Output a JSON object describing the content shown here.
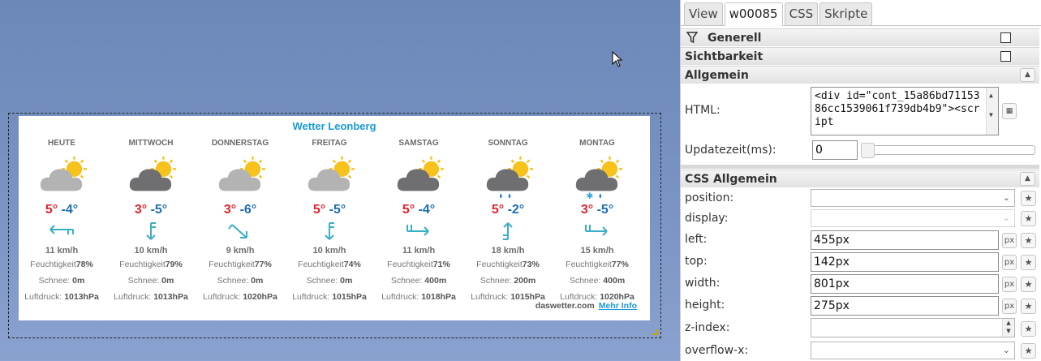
{
  "widget": {
    "title": "Wetter Leonberg",
    "source": "daswetter.com",
    "more_info": "Mehr Info",
    "labels": {
      "humidity": "Feuchtigkeit",
      "snow": "Schnee:",
      "pressure": "Luftdruck:"
    },
    "days": [
      {
        "name": "HEUTE",
        "icon": "partly-cloudy-icon",
        "max": "5°",
        "min": "-4°",
        "wind_icon": "wind-arrow-west-icon",
        "wind": "11 km/h",
        "humidity": "78%",
        "snow": "0m",
        "pressure": "1013hPa"
      },
      {
        "name": "MITTWOCH",
        "icon": "cloudy-sun-icon",
        "max": "3°",
        "min": "-5°",
        "wind_icon": "wind-arrow-south-icon",
        "wind": "10 km/h",
        "humidity": "79%",
        "snow": "0m",
        "pressure": "1013hPa"
      },
      {
        "name": "DONNERSTAG",
        "icon": "partly-cloudy-icon",
        "max": "3°",
        "min": "-6°",
        "wind_icon": "wind-arrow-southeast-icon",
        "wind": "9 km/h",
        "humidity": "77%",
        "snow": "0m",
        "pressure": "1020hPa"
      },
      {
        "name": "FREITAG",
        "icon": "partly-cloudy-icon",
        "max": "5°",
        "min": "-5°",
        "wind_icon": "wind-arrow-south-icon",
        "wind": "10 km/h",
        "humidity": "74%",
        "snow": "0m",
        "pressure": "1015hPa"
      },
      {
        "name": "SAMSTAG",
        "icon": "cloudy-sun-icon",
        "max": "5°",
        "min": "-4°",
        "wind_icon": "wind-arrow-east-icon",
        "wind": "11 km/h",
        "humidity": "71%",
        "snow": "400m",
        "pressure": "1018hPa"
      },
      {
        "name": "SONNTAG",
        "icon": "rain-icon",
        "max": "5°",
        "min": "-2°",
        "wind_icon": "wind-arrow-north-icon",
        "wind": "18 km/h",
        "humidity": "73%",
        "snow": "200m",
        "pressure": "1015hPa"
      },
      {
        "name": "MONTAG",
        "icon": "sleet-icon",
        "max": "3°",
        "min": "-5°",
        "wind_icon": "wind-arrow-east-icon",
        "wind": "15 km/h",
        "humidity": "77%",
        "snow": "400m",
        "pressure": "1020hPa"
      }
    ]
  },
  "panel": {
    "tabs": [
      "View",
      "w00085",
      "CSS",
      "Skripte"
    ],
    "active_tab": "w00085",
    "sections": {
      "generell": "Generell",
      "sichtbarkeit": "Sichtbarkeit",
      "allgemein": "Allgemein",
      "css_allgemein": "CSS Allgemein"
    },
    "html_label": "HTML:",
    "html_value": "<div id=\"cont_15a86bd7115386cc1539061f739db4b9\"><script",
    "update_label": "Updatezeit(ms):",
    "update_value": "0",
    "px_unit": "px",
    "css": {
      "position": {
        "label": "position:",
        "value": ""
      },
      "display": {
        "label": "display:",
        "value": ""
      },
      "left": {
        "label": "left:",
        "value": "455px"
      },
      "top": {
        "label": "top:",
        "value": "142px"
      },
      "width": {
        "label": "width:",
        "value": "801px"
      },
      "height": {
        "label": "height:",
        "value": "275px"
      },
      "z_index": {
        "label": "z-index:",
        "value": ""
      },
      "overflow_x": {
        "label": "overflow-x:",
        "value": ""
      }
    }
  },
  "colors": {
    "canvas_bg": "#7a95c4",
    "title_blue": "#1b9ad6",
    "temp_max": "#e3232f",
    "temp_min": "#1d6fb3",
    "wind_arrow": "#3aaec4"
  }
}
